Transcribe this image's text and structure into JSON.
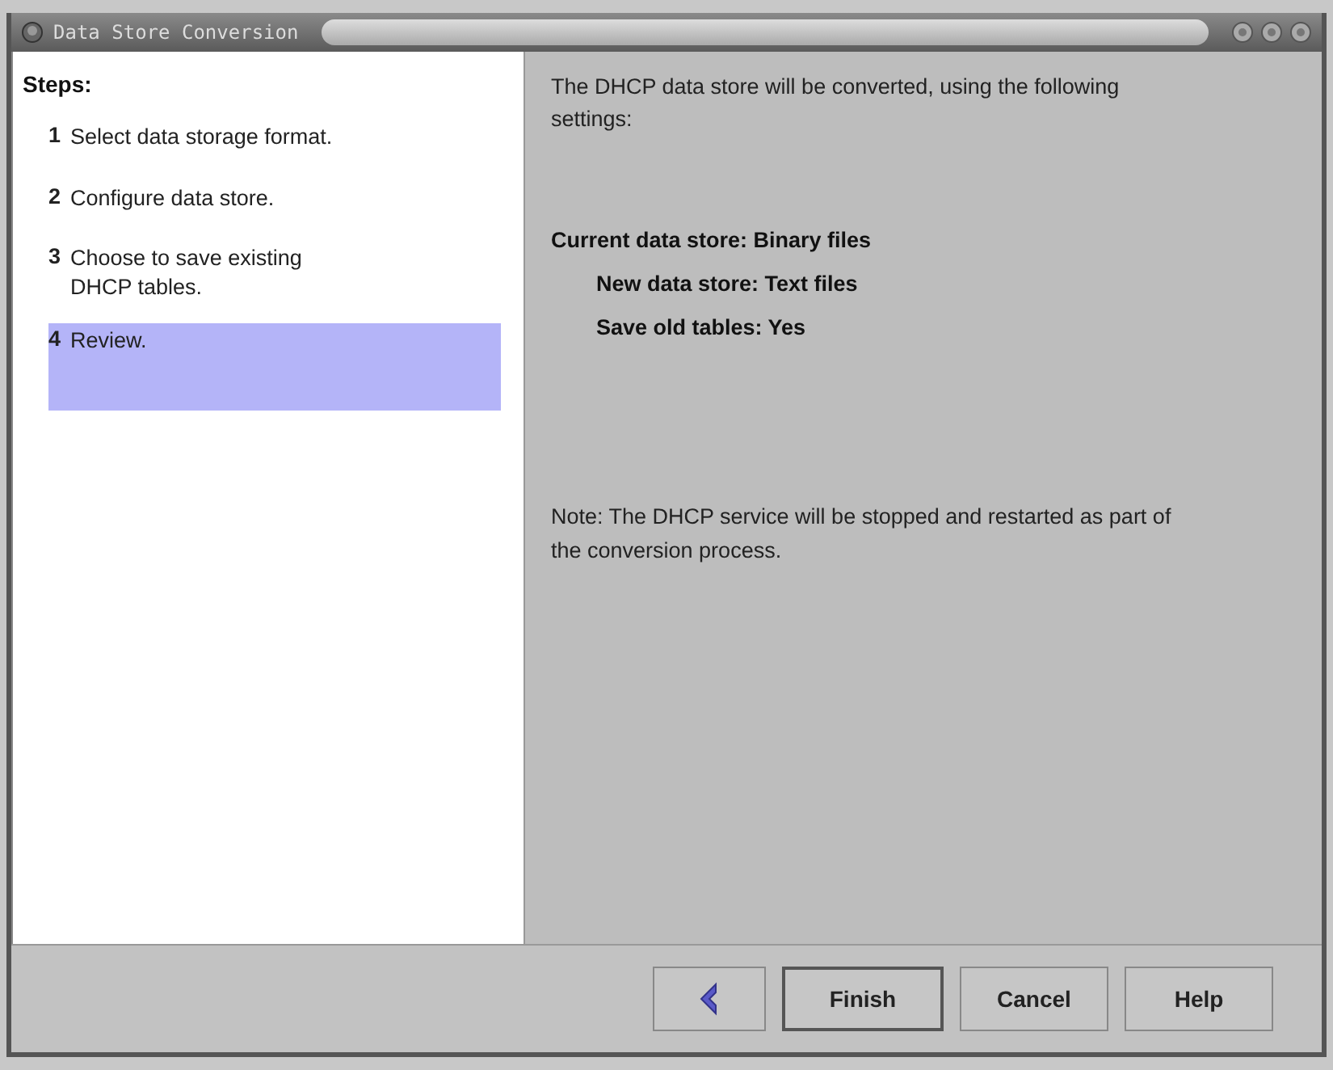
{
  "window": {
    "title": "Data Store Conversion"
  },
  "steps": {
    "heading": "Steps:",
    "items": [
      {
        "number": "1",
        "label": "Select data storage format.",
        "selected": false
      },
      {
        "number": "2",
        "label": "Configure data store.",
        "selected": false
      },
      {
        "number": "3",
        "label": "Choose to save existing DHCP tables.",
        "selected": false
      },
      {
        "number": "4",
        "label": "Review.",
        "selected": true
      }
    ]
  },
  "review": {
    "intro": "The DHCP data store will be converted, using the following settings:",
    "settings": [
      {
        "label": "Current data store:",
        "value": "Binary files"
      },
      {
        "label": "New data store:",
        "value": "Text files"
      },
      {
        "label": "Save old tables:",
        "value": "Yes"
      }
    ],
    "note": "Note: The DHCP service will be stopped and restarted as part of the conversion process."
  },
  "buttons": [
    "Finish",
    "Cancel",
    "Help"
  ]
}
